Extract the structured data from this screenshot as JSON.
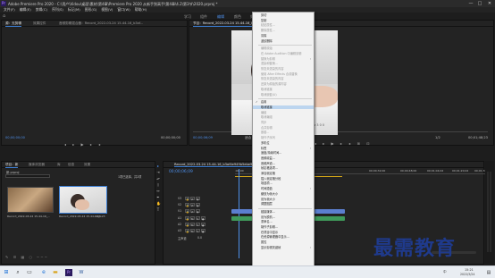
{
  "window": {
    "title": "Adobe Premiere Pro 2020 - C:\\用户\\Vidou\\桌面\\素材\\第4章\\Premiere Pro 2020 从新手到高手\\第4章\\4.2\\第3节\\2020.prproj *",
    "minimize": "—",
    "maximize": "□",
    "close": "✕"
  },
  "menu": [
    "文件(F)",
    "编辑(E)",
    "剪辑(C)",
    "序列(S)",
    "标记(M)",
    "图形(G)",
    "视图(V)",
    "窗口(W)",
    "帮助(H)"
  ],
  "workspaces": {
    "items": [
      "学习",
      "组件",
      "编辑",
      "颜色",
      "效果"
    ],
    "active_index": 2
  },
  "source_panel": {
    "tabs": [
      "源：无剪辑",
      "效果控件",
      "音频剪辑混合器：Record_2022-03-24 15-44-16_b3af..."
    ],
    "timecode": "00;00;00;00",
    "timecode_right": "00;00;00;00"
  },
  "program_panel": {
    "tab": "节目：Record_2022-03-24 15-44-16_b3af4e949b5ebe...",
    "timecode": "00;00;06;09",
    "fit": "适合",
    "ratio": "1/2",
    "timecode_right": "00;01;48;23",
    "subtitle": "Tow 3 0 0"
  },
  "project_panel": {
    "tabs": [
      "项目：新",
      "媒体浏览器",
      "库",
      "信息",
      "效果"
    ],
    "file": "新.prproj",
    "count": "1项已选择，共2项",
    "clips": [
      {
        "name": "Record_2022-03-24 15-44-16_...",
        "duration": "1:48:23"
      },
      {
        "name": "Record_2022-03-24 15-44-16_...",
        "duration": "1:48:23"
      }
    ]
  },
  "timeline": {
    "tab": "Record_2022-03-24 15-44-16_b3af4e949b5ebe98ec...",
    "timecode": "00;00;06;09",
    "ruler": [
      ":00;00",
      "00;00;16;00",
      "00;00;32;00",
      "00;00;48;00",
      "00;01;04;02",
      "00;01;20;02",
      "00;01;36;02"
    ],
    "tracks": [
      "V3",
      "V2",
      "V1",
      "A1",
      "A2",
      "A3"
    ],
    "master": "主声道",
    "master_val": "0.0"
  },
  "context_menu": {
    "items": [
      {
        "label": "剪切",
        "state": "normal"
      },
      {
        "label": "复制",
        "state": "normal"
      },
      {
        "label": "粘贴属性...",
        "state": "disabled"
      },
      {
        "label": "删除属性...",
        "state": "disabled"
      },
      {
        "label": "清除",
        "state": "normal"
      },
      {
        "label": "波纹删除",
        "state": "normal"
      },
      {
        "sep": true
      },
      {
        "label": "编辑原始",
        "state": "disabled"
      },
      {
        "label": "在 Adobe Audition 中编辑剪辑",
        "state": "disabled"
      },
      {
        "label": "替换为剪辑",
        "state": "disabled",
        "sub": true
      },
      {
        "label": "渲染和替换...",
        "state": "disabled"
      },
      {
        "label": "恢复未渲染的内容",
        "state": "disabled"
      },
      {
        "label": "使用 After Effects 合成替换",
        "state": "disabled"
      },
      {
        "label": "恢复未渲染的内容",
        "state": "disabled"
      },
      {
        "label": "还原为原始的源内容",
        "state": "disabled"
      },
      {
        "label": "取消链接",
        "state": "disabled"
      },
      {
        "label": "取消嵌套(U)",
        "state": "disabled"
      },
      {
        "sep": true
      },
      {
        "label": "启用",
        "state": "normal",
        "check": true
      },
      {
        "label": "取消链接",
        "state": "highlight"
      },
      {
        "label": "编组",
        "state": "disabled"
      },
      {
        "label": "取消编组",
        "state": "disabled"
      },
      {
        "label": "同步",
        "state": "disabled"
      },
      {
        "label": "合并剪辑",
        "state": "disabled"
      },
      {
        "label": "嵌套...",
        "state": "disabled"
      },
      {
        "label": "制作子序列",
        "state": "disabled"
      },
      {
        "label": "多机位",
        "state": "normal"
      },
      {
        "label": "标签",
        "state": "normal",
        "sub": true
      },
      {
        "label": "速度/持续时间...",
        "state": "normal"
      },
      {
        "label": "音频增益...",
        "state": "normal"
      },
      {
        "label": "音频声道...",
        "state": "normal"
      },
      {
        "label": "帧定格选项...",
        "state": "normal"
      },
      {
        "label": "添加帧定格",
        "state": "normal"
      },
      {
        "label": "插入帧定格分段",
        "state": "normal"
      },
      {
        "label": "场选项...",
        "state": "normal"
      },
      {
        "label": "时间插值",
        "state": "normal",
        "sub": true
      },
      {
        "label": "缩放为帧大小",
        "state": "normal"
      },
      {
        "label": "设为帧大小",
        "state": "normal"
      },
      {
        "label": "调整图层",
        "state": "normal"
      },
      {
        "sep": true
      },
      {
        "label": "链接媒体...",
        "state": "normal"
      },
      {
        "label": "设为脱机...",
        "state": "normal"
      },
      {
        "label": "重命名...",
        "state": "normal"
      },
      {
        "label": "制作子剪辑...",
        "state": "normal"
      },
      {
        "label": "在项目中显示",
        "state": "normal"
      },
      {
        "label": "在资源管理器中显示...",
        "state": "normal"
      },
      {
        "label": "属性",
        "state": "normal"
      },
      {
        "label": "显示剪辑关键帧",
        "state": "normal",
        "sub": true
      }
    ]
  },
  "watermark": "最需教育",
  "taskbar": {
    "clock_time": "15:21",
    "clock_date": "2022/3/24",
    "lang": "中"
  },
  "colors": {
    "accent_blue": "#3c7fd6",
    "timecode_blue": "#4d8ee8",
    "menu_highlight": "#bcd5ef",
    "video_clip": "#5b7fcf",
    "audio_clip": "#3f9a5a",
    "watermark": "#1f3a8c"
  }
}
